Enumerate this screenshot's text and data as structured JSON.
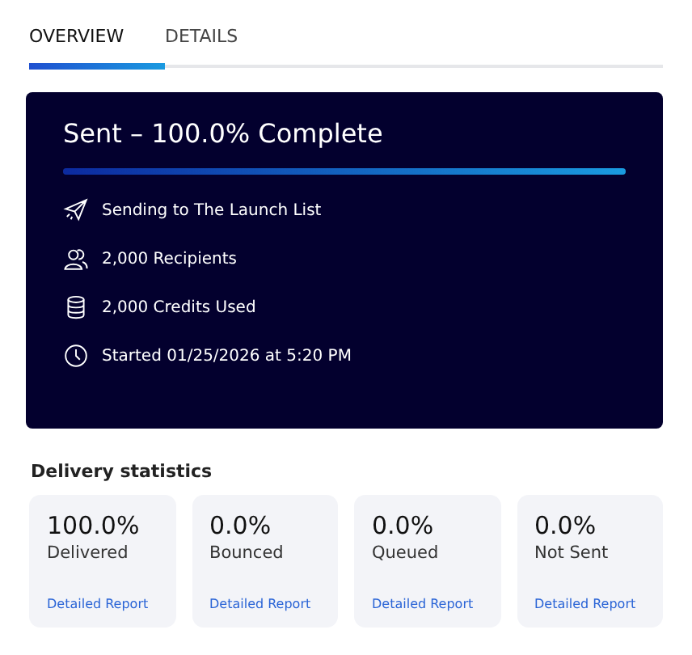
{
  "tabs": [
    {
      "label": "OVERVIEW",
      "selected": true
    },
    {
      "label": "DETAILS",
      "selected": false
    }
  ],
  "summary": {
    "title": "Sent – 100.0% Complete",
    "level": 1.0,
    "items": [
      {
        "kind": "send",
        "text": "Sending to The Launch List"
      },
      {
        "kind": "recipients",
        "text": "2,000 Recipients"
      },
      {
        "kind": "credits",
        "text": "2,000 Credits Used"
      },
      {
        "kind": "time",
        "text": "Started 01/25/2026 at 5:20 PM"
      }
    ]
  },
  "delivery_statistics": {
    "heading": "Delivery statistics",
    "cards": [
      {
        "value": "100.0%",
        "label": "Delivered",
        "link": "Detailed Report"
      },
      {
        "value": "0.0%",
        "label": "Bounced",
        "link": "Detailed Report"
      },
      {
        "value": "0.0%",
        "label": "Queued",
        "link": "Detailed Report"
      },
      {
        "value": "0.0%",
        "label": "Not Sent",
        "link": "Detailed Report"
      }
    ]
  }
}
